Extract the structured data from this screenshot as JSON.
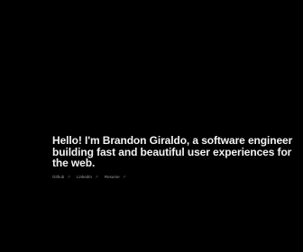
{
  "intro": {
    "headline": "Hello! I'm Brandon Giraldo, a software engineer building fast and beautiful user experiences for the web."
  },
  "links": [
    {
      "label": "Github"
    },
    {
      "label": "LinkedIn"
    },
    {
      "label": "Resume"
    }
  ],
  "separator": "↗",
  "colors": {
    "background": "#000000",
    "headline": "#f2f2f2",
    "link": "#9a9a9a"
  }
}
